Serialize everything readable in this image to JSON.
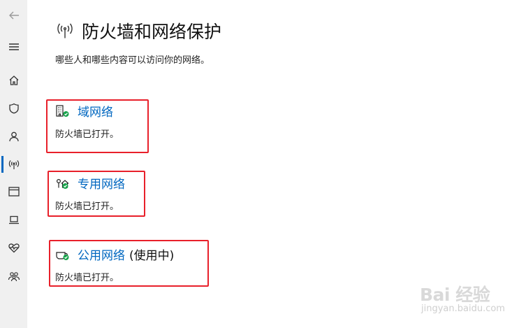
{
  "page": {
    "title": "防火墙和网络保护",
    "subtitle": "哪些人和哪些内容可以访问你的网络。"
  },
  "sidebar": {
    "items": [
      {
        "icon": "back-arrow-icon"
      },
      {
        "icon": "hamburger-menu-icon"
      },
      {
        "icon": "home-icon"
      },
      {
        "icon": "shield-icon"
      },
      {
        "icon": "account-icon"
      },
      {
        "icon": "network-antenna-icon",
        "active": true
      },
      {
        "icon": "app-browser-icon"
      },
      {
        "icon": "laptop-icon"
      },
      {
        "icon": "health-heart-icon"
      },
      {
        "icon": "family-icon"
      }
    ]
  },
  "networks": [
    {
      "label": "域网络",
      "badge": "",
      "status": "防火墙已打开。",
      "icon": "domain-network-icon"
    },
    {
      "label": "专用网络",
      "badge": "",
      "status": "防火墙已打开。",
      "icon": "private-network-icon"
    },
    {
      "label": "公用网络",
      "badge": "(使用中)",
      "status": "防火墙已打开。",
      "icon": "public-network-icon"
    }
  ],
  "watermark": {
    "main": "Bai 经验",
    "sub": "jingyan.baidu.com"
  },
  "colors": {
    "accent": "#0067c0",
    "highlight": "#e8202a",
    "status_ok": "#16a34a",
    "sidebar_bg": "#f0f0f0"
  }
}
